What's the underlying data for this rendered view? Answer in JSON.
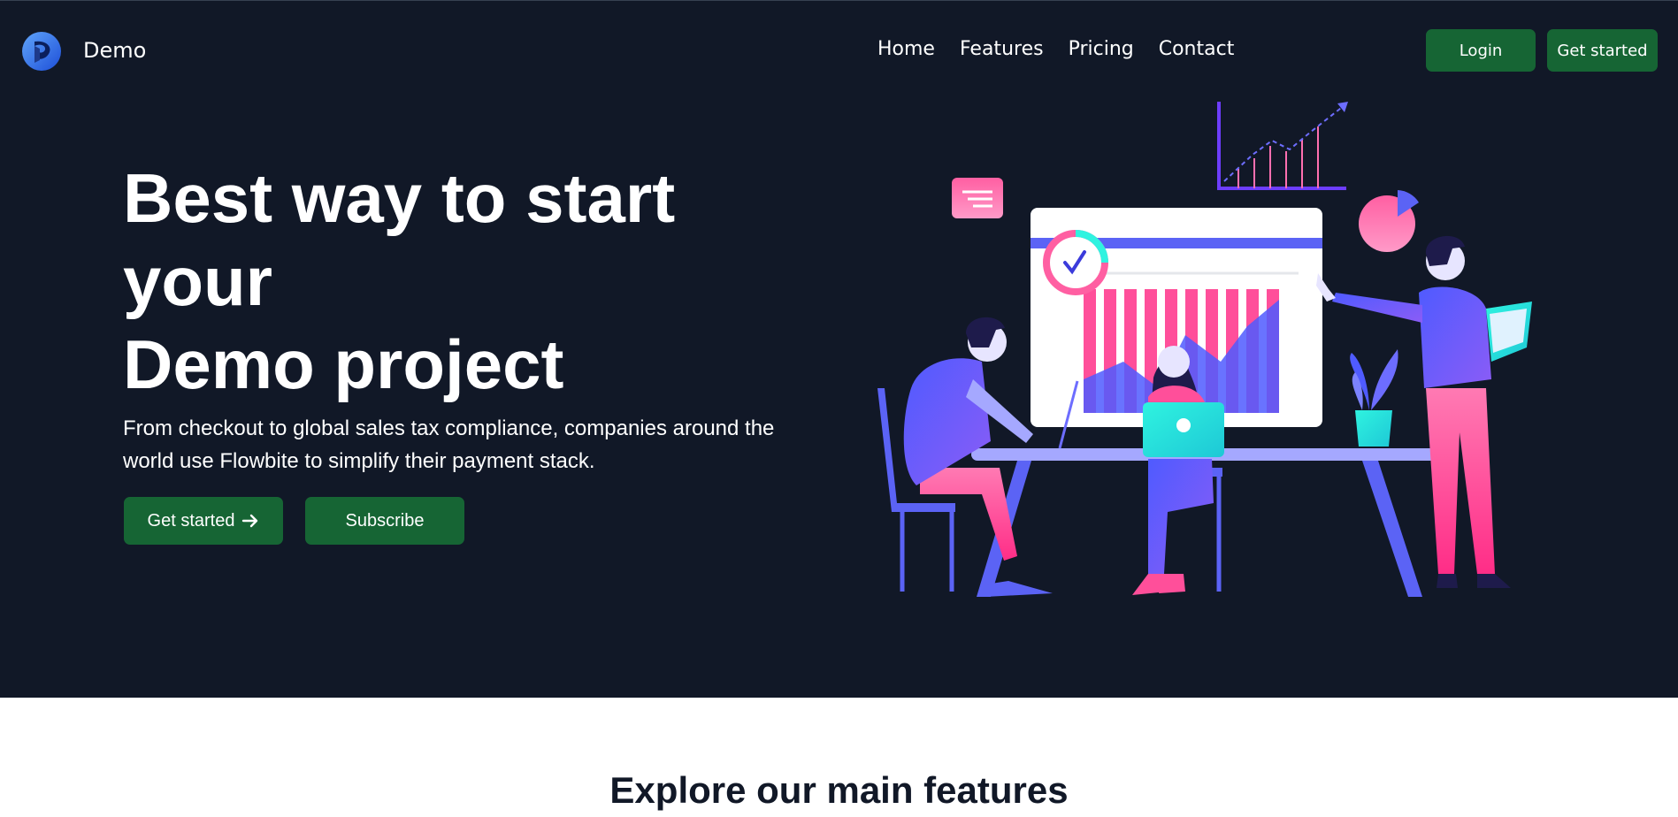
{
  "header": {
    "brand": "Demo",
    "nav": [
      "Home",
      "Features",
      "Pricing",
      "Contact"
    ],
    "login_label": "Login",
    "get_started_label": "Get started"
  },
  "hero": {
    "headline": [
      "Best way to start",
      "your",
      "Demo project"
    ],
    "description": "From checkout to global sales tax compliance, companies around the world use Flowbite to simplify their payment stack.",
    "primary_cta": "Get started",
    "secondary_cta": "Subscribe"
  },
  "features": {
    "title": "Explore our main features"
  },
  "icons": {
    "logo": "flowbite-logo-icon",
    "cta_arrow": "arrow-right-icon"
  },
  "colors": {
    "hero_background": "#111827",
    "button_green": "#166534",
    "page_background": "#ffffff",
    "text_dark": "#111827"
  }
}
